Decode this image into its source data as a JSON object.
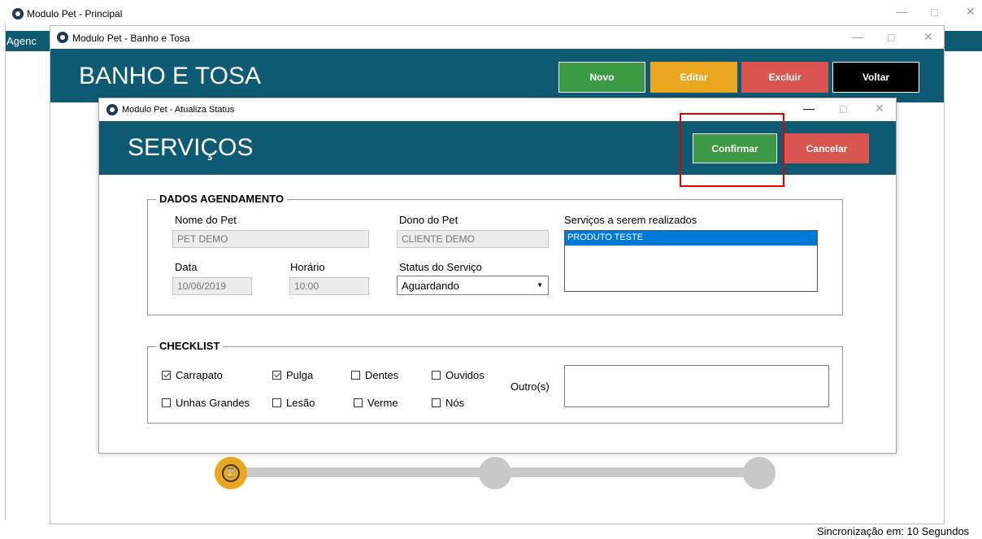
{
  "main_window": {
    "title": "Modulo Pet - Principal",
    "menu_item": "Agenc"
  },
  "banho_window": {
    "title": "Modulo Pet - Banho e Tosa",
    "header_title": "BANHO E TOSA",
    "buttons": {
      "novo": "Novo",
      "editar": "Editar",
      "excluir": "Excluir",
      "voltar": "Voltar"
    }
  },
  "status_dialog": {
    "title": "Modulo Pet -  Atualiza Status",
    "header_title": "SERVIÇOS",
    "buttons": {
      "confirmar": "Confirmar",
      "cancelar": "Cancelar"
    },
    "dados": {
      "group_title": "DADOS AGENDAMENTO",
      "nome_pet_label": "Nome do Pet",
      "nome_pet_value": "PET DEMO",
      "dono_pet_label": "Dono do Pet",
      "dono_pet_value": "CLIENTE DEMO",
      "data_label": "Data",
      "data_value": "10/06/2019",
      "horario_label": "Horário",
      "horario_value": "10:00",
      "status_label": "Status do Serviço",
      "status_value": "Aguardando",
      "servicos_label": "Serviços a serem realizados",
      "servicos_items": [
        "PRODUTO TESTE"
      ]
    },
    "checklist": {
      "group_title": "CHECKLIST",
      "items": {
        "carrapato": {
          "label": "Carrapato",
          "checked": true
        },
        "pulga": {
          "label": "Pulga",
          "checked": true
        },
        "dentes": {
          "label": "Dentes",
          "checked": false
        },
        "ouvidos": {
          "label": "Ouvidos",
          "checked": false
        },
        "unhas": {
          "label": "Unhas Grandes",
          "checked": false
        },
        "lesao": {
          "label": "Lesão",
          "checked": false
        },
        "verme": {
          "label": "Verme",
          "checked": false
        },
        "nos": {
          "label": "Nós",
          "checked": false
        }
      },
      "outros_label": "Outro(s)",
      "outros_value": ""
    }
  },
  "status_bar": {
    "sync_text": "Sincronização em: 10 Segundos"
  },
  "colors": {
    "header_bg": "#0f5a73",
    "novo": "#3c9a45",
    "editar": "#eba61f",
    "excluir": "#d95550",
    "voltar": "#000000",
    "confirmar": "#3c9a45",
    "cancelar": "#d95550",
    "highlight": "#e00000",
    "progress_active": "#eba61f",
    "progress_inactive": "#c8c8c8"
  }
}
